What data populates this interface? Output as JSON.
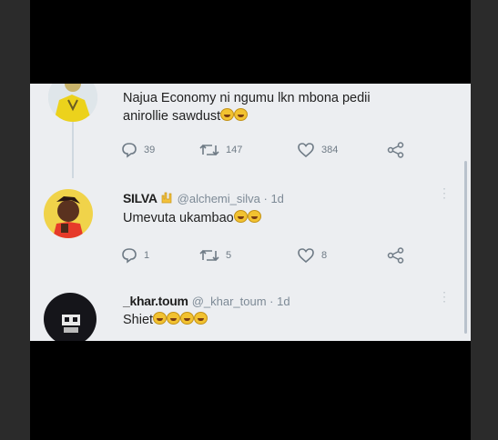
{
  "tweets": [
    {
      "text_line1": "Najua Economy ni ngumu lkn mbona pedii",
      "text_line2": "anirollie sawdust",
      "replies": "39",
      "retweets": "147",
      "likes": "384"
    },
    {
      "name": "SILVA",
      "handle": "@alchemi_silva · 1d",
      "text": "Umevuta ukambao",
      "replies": "1",
      "retweets": "5",
      "likes": "8"
    },
    {
      "name": "_khar.toum",
      "handle": "@_khar_toum · 1d",
      "text": "Shiet"
    }
  ],
  "icons": [
    "reply-icon",
    "retweet-icon",
    "like-icon",
    "share-icon",
    "more-icon",
    "laughing-emoji-icon",
    "rock-on-emoji-icon"
  ],
  "colors": {
    "background": "#eceef1",
    "action_gray": "#6f7b86",
    "handle_gray": "#7d8a96"
  }
}
